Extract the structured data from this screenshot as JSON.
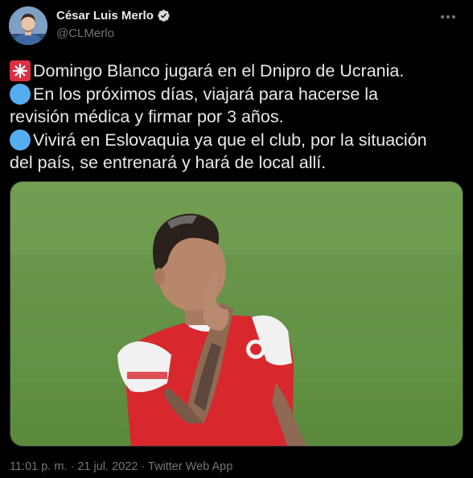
{
  "author": {
    "display_name": "César Luis Merlo",
    "handle": "@CLMerlo",
    "verified": true
  },
  "tweet": {
    "lines": [
      {
        "emoji": "police-siren-icon",
        "text": "Domingo Blanco jugará en el Dnipro de Ucrania."
      },
      {
        "emoji": "blue-circle-icon",
        "text": "En los próximos días, viajará para hacerse la"
      },
      {
        "emoji": "",
        "text": "revisión médica y firmar por 3 años."
      },
      {
        "emoji": "blue-circle-icon",
        "text": "Vivirá en Eslovaquia ya que el club, por la situación"
      },
      {
        "emoji": "",
        "text": "del país, se entrenará y hará de local allí."
      }
    ],
    "timestamp": "11:01 p. m. · 21 jul. 2022 · Twitter Web App"
  },
  "media": {
    "description_icon": "photo-football-player"
  },
  "colors": {
    "background": "#000000",
    "text": "#e7e9ea",
    "secondary_text": "#71767b",
    "verified_badge": "#d9d9d9",
    "emoji_blue": "#55acee",
    "emoji_red": "#dd2e44"
  }
}
